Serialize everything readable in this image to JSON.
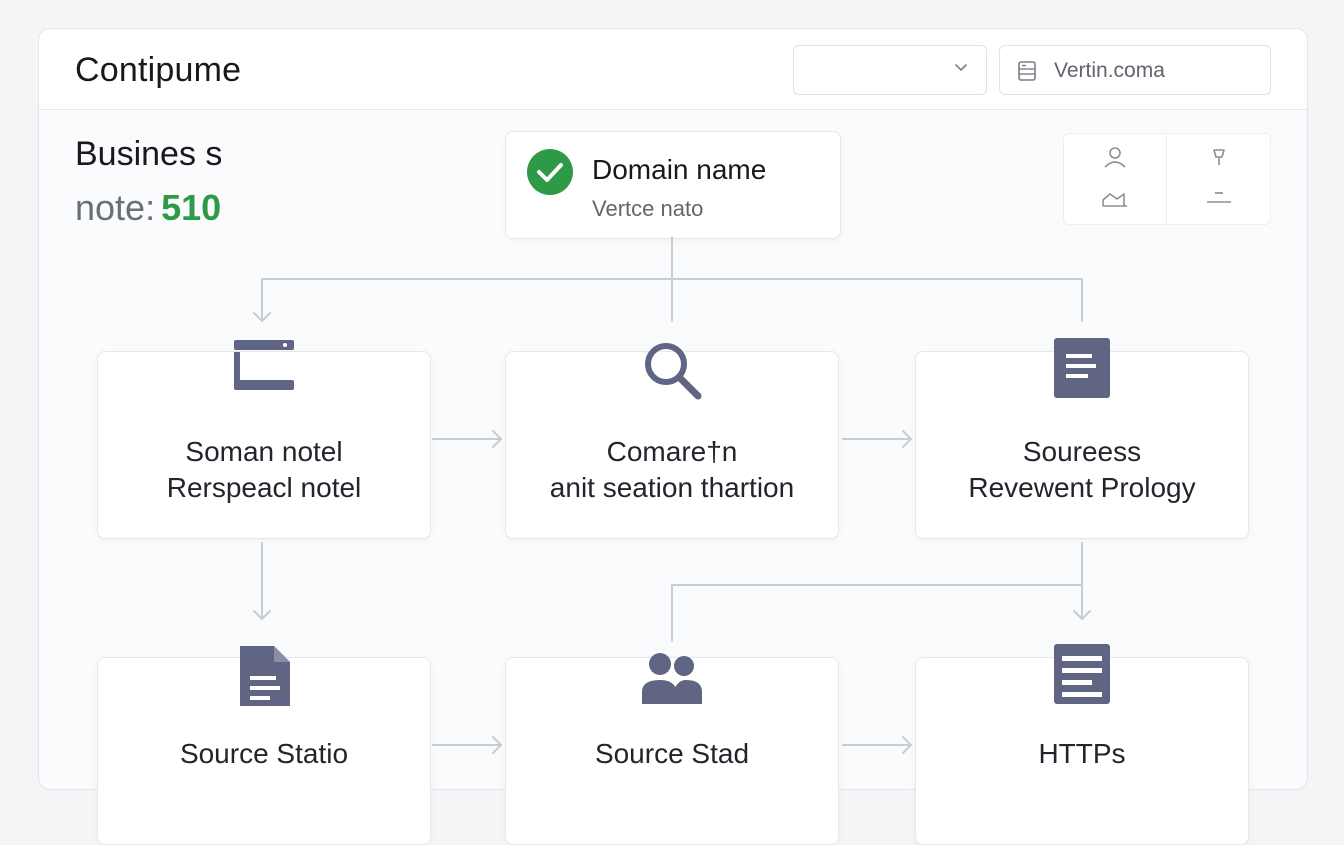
{
  "header": {
    "app_title": "Contipume",
    "select_value": "",
    "domain_value": "Vertin.coma"
  },
  "business": {
    "title": "Busines s",
    "note_label": "note:",
    "note_value": "510"
  },
  "status_card": {
    "title": "Domain name",
    "subtitle": "Vertce nato"
  },
  "colors": {
    "accent_green": "#2e9a47",
    "icon_slate": "#5f6582",
    "connector": "#c9ccd3"
  },
  "nodes": [
    {
      "icon": "server-icon",
      "line1": "Soman notel",
      "line2": "Rerspeacl notel"
    },
    {
      "icon": "search-icon",
      "line1": "Comare†n",
      "line2": "anit seation thartion"
    },
    {
      "icon": "document-icon",
      "line1": "Soureess",
      "line2": "Revewent Prology"
    },
    {
      "icon": "file-icon",
      "line1": "Source Statio"
    },
    {
      "icon": "users-icon",
      "line1": "Source Stad"
    },
    {
      "icon": "list-icon",
      "line1": "HTTPs"
    }
  ]
}
